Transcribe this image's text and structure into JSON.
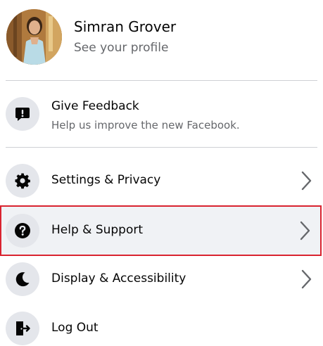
{
  "profile": {
    "name": "Simran Grover",
    "subtitle": "See your profile"
  },
  "feedback": {
    "title": "Give Feedback",
    "subtitle": "Help us improve the new Facebook.",
    "icon": "exclamation-icon"
  },
  "menu_items": [
    {
      "label": "Settings & Privacy",
      "icon": "gear-icon",
      "has_chevron": true,
      "highlighted": false
    },
    {
      "label": "Help & Support",
      "icon": "question-icon",
      "has_chevron": true,
      "highlighted": true
    },
    {
      "label": "Display & Accessibility",
      "icon": "moon-icon",
      "has_chevron": true,
      "highlighted": false
    },
    {
      "label": "Log Out",
      "icon": "logout-icon",
      "has_chevron": false,
      "highlighted": false
    }
  ],
  "colors": {
    "highlight_border": "#d9232f",
    "icon_background": "#e4e6eb",
    "secondary_text": "#65676b"
  }
}
